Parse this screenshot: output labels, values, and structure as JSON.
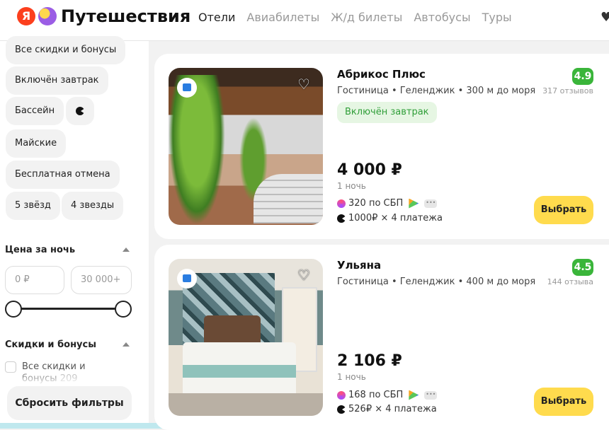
{
  "header": {
    "logo_letter": "Я",
    "brand": "Путешествия",
    "nav": [
      "Отели",
      "Авиабилеты",
      "Ж/д билеты",
      "Автобусы",
      "Туры"
    ],
    "active_nav": "Отели"
  },
  "filters": {
    "chips": [
      "Все скидки и бонусы",
      "Включён завтрак",
      "Бассейн",
      "Майские",
      "Бесплатная отмена",
      "5 звёзд",
      "4 звезды"
    ],
    "price_title": "Цена за ночь",
    "price_from_placeholder": "0 ₽",
    "price_to_placeholder": "30 000+",
    "price_range": [
      0,
      1
    ],
    "discounts_title": "Скидки и бонусы",
    "discount_option_label": "Все скидки и бонусы",
    "discount_option_count": "209",
    "reset_label": "Сбросить фильтры"
  },
  "hotels": [
    {
      "name": "Абрикос Плюс",
      "meta": "Гостиница • Геленджик • 300 м до моря",
      "rating": "4.9",
      "reviews": "317 отзывов",
      "tag": "Включён завтрак",
      "price": "4 000 ₽",
      "nights": "1 ночь",
      "sbp_bonus": "320 по СБП",
      "installment": "1000₽ × 4 платежа",
      "more": "•••",
      "choose_label": "Выбрать"
    },
    {
      "name": "Ульяна",
      "meta": "Гостиница • Геленджик • 400 м до моря",
      "rating": "4.5",
      "reviews": "144 отзыва",
      "price": "2 106 ₽",
      "nights": "1 ночь",
      "sbp_bonus": "168 по СБП",
      "installment": "526₽ × 4 платежа",
      "more": "•••",
      "choose_label": "Выбрать"
    }
  ],
  "colors": {
    "rating_green": "#3ab53a",
    "choose_yellow": "#ffdb4d",
    "brand_red": "#fc3f1d"
  }
}
